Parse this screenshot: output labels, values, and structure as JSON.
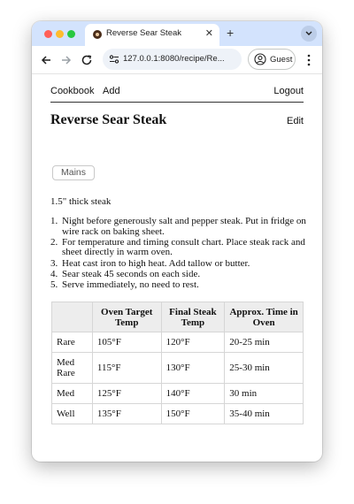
{
  "browser": {
    "tab_title": "Reverse Sear Steak",
    "url": "127.0.0.1:8080/recipe/Re...",
    "profile_label": "Guest"
  },
  "nav": {
    "cookbook": "Cookbook",
    "add": "Add",
    "logout": "Logout"
  },
  "recipe": {
    "title": "Reverse Sear Steak",
    "edit_label": "Edit",
    "tag": "Mains",
    "summary": "1.5\" thick steak",
    "steps": [
      "Night before generously salt and pepper steak. Put in fridge on wire rack on baking sheet.",
      "For temperature and timing consult chart. Place steak rack and sheet directly in warm oven.",
      "Heat cast iron to high heat. Add tallow or butter.",
      "Sear steak 45 seconds on each side.",
      "Serve immediately, no need to rest."
    ],
    "step_numbers": [
      "1.",
      "2.",
      "3.",
      "4.",
      "5."
    ]
  },
  "chart": {
    "headers": [
      "",
      "Oven Target Temp",
      "Final Steak Temp",
      "Approx. Time in Oven"
    ],
    "rows": [
      [
        "Rare",
        "105°F",
        "120°F",
        "20-25 min"
      ],
      [
        "Med Rare",
        "115°F",
        "130°F",
        "25-30 min"
      ],
      [
        "Med",
        "125°F",
        "140°F",
        "30 min"
      ],
      [
        "Well",
        "135°F",
        "150°F",
        "35-40 min"
      ]
    ]
  }
}
